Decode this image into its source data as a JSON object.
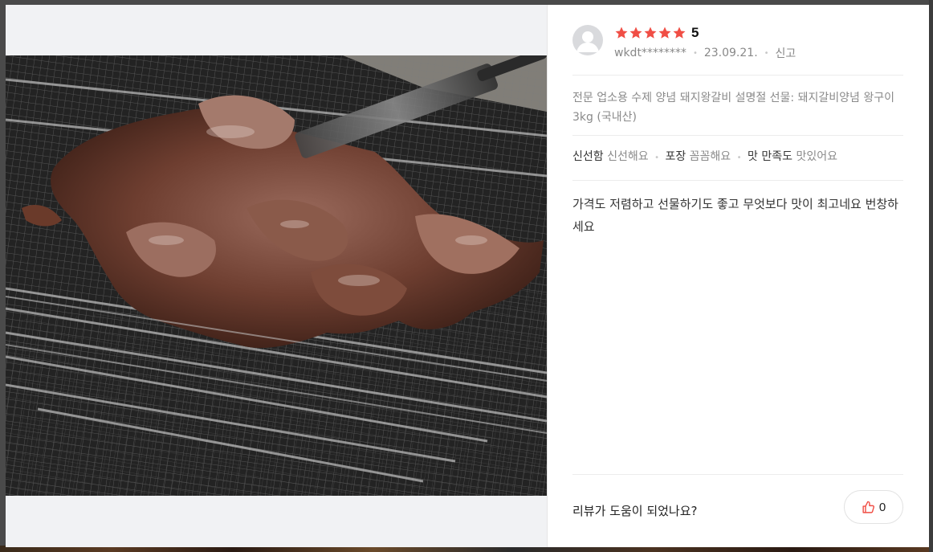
{
  "review": {
    "rating_value": "5",
    "stars_filled": 5,
    "star_color": "#f04e45",
    "user_id": "wkdt********",
    "date": "23.09.21.",
    "report_label": "신고",
    "product_name": "전문 업소용 수제 양념 돼지왕갈비 설명절 선물: 돼지갈비양념 왕구이 3kg (국내산)",
    "attributes": [
      {
        "label": "신선함",
        "value": "신선해요"
      },
      {
        "label": "포장",
        "value": "꼼꼼해요"
      },
      {
        "label": "맛 만족도",
        "value": "맛있어요"
      }
    ],
    "text": "가격도 저렴하고 선물하기도 좋고 무엇보다 맛이 최고네요 번창하세요"
  },
  "footer": {
    "question": "리뷰가 도움이 되었나요?",
    "like_count": "0",
    "like_icon_color": "#f04e45"
  },
  "icons": {
    "avatar": "default-user-avatar-icon",
    "star": "star-icon",
    "like": "thumbs-up-icon"
  },
  "photo": {
    "subject": "marinated pork ribs grilling on wire mesh"
  }
}
